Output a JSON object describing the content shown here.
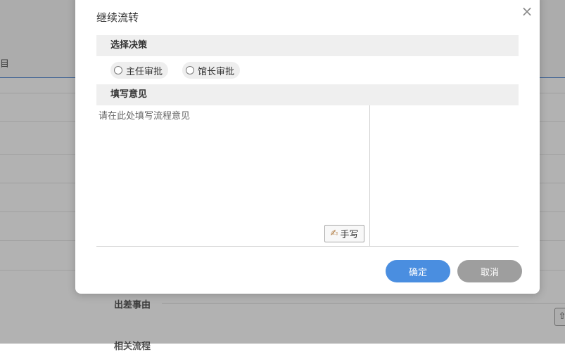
{
  "background": {
    "header_fragment": "目",
    "section_label": "出差事由",
    "bottom_label": "相关流程",
    "upload_icon_glyph": "⇧"
  },
  "dialog": {
    "title": "继续流转",
    "close_glyph": "×",
    "decision_section": {
      "label": "选择决策",
      "options": [
        {
          "label": "主任审批",
          "selected": false
        },
        {
          "label": "馆长审批",
          "selected": false
        }
      ]
    },
    "opinion_section": {
      "label": "填写意见",
      "placeholder": "请在此处填写流程意见",
      "value": "",
      "handwrite_label": "手写",
      "handwrite_icon": "pen-icon"
    },
    "buttons": {
      "confirm_label": "确定",
      "cancel_label": "取消"
    }
  },
  "colors": {
    "confirm": "#4a8ee0",
    "cancel": "#9e9e9e",
    "section_bar": "#efefef",
    "accent_rule": "#5b8fd6"
  }
}
